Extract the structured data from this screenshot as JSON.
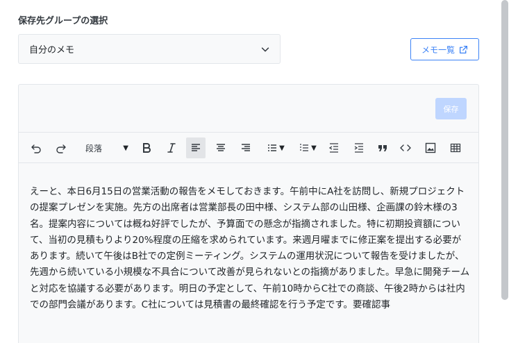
{
  "group_selector": {
    "label": "保存先グループの選択",
    "selected": "自分のメモ"
  },
  "memo_list_button": {
    "label": "メモ一覧"
  },
  "editor": {
    "save_label": "保存",
    "toolbar": {
      "paragraph_label": "段落"
    },
    "content": "えーと、本日6月15日の営業活動の報告をメモしておきます。午前中にA社を訪問し、新規プロジェクトの提案プレゼンを実施。先方の出席者は営業部長の田中様、システム部の山田様、企画課の鈴木様の3名。提案内容については概ね好評でしたが、予算面での懸念が指摘されました。特に初期投資額について、当初の見積もりより20%程度の圧縮を求められています。来週月曜までに修正案を提出する必要があります。続いて午後はB社での定例ミーティング。システムの運用状況について報告を受けましたが、先週から続いている小規模な不具合について改善が見られないとの指摘がありました。早急に開発チームと対応を協議する必要があります。明日の予定として、午前10時からC社での商談、午後2時からは社内での部門会議があります。C社については見積書の最終確認を行う予定です。要確認事"
  },
  "colors": {
    "accent": "#3b82f6",
    "save_disabled": "#bfd6ff",
    "panel_bg": "#f8f9fa",
    "border": "#e3e6ea"
  }
}
